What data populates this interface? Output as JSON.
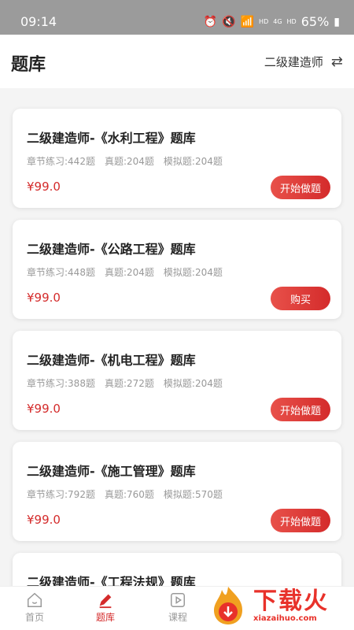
{
  "status_bar": {
    "time": "09:14",
    "hd1": "HD",
    "net": "4G",
    "hd2": "HD",
    "battery": "65%"
  },
  "header": {
    "title": "题库",
    "exam_type": "二级建造师"
  },
  "cards": [
    {
      "title": "二级建造师-《水利工程》题库",
      "chapter": "章节练习:442题",
      "real": "真题:204题",
      "mock": "模拟题:204题",
      "price": "¥99.0",
      "button": "开始做题"
    },
    {
      "title": "二级建造师-《公路工程》题库",
      "chapter": "章节练习:448题",
      "real": "真题:204题",
      "mock": "模拟题:204题",
      "price": "¥99.0",
      "button": "购买"
    },
    {
      "title": "二级建造师-《机电工程》题库",
      "chapter": "章节练习:388题",
      "real": "真题:272题",
      "mock": "模拟题:204题",
      "price": "¥99.0",
      "button": "开始做题"
    },
    {
      "title": "二级建造师-《施工管理》题库",
      "chapter": "章节练习:792题",
      "real": "真题:760题",
      "mock": "模拟题:570题",
      "price": "¥99.0",
      "button": "开始做题"
    },
    {
      "title": "二级建造师-《工程法规》题库"
    }
  ],
  "tabbar": {
    "home": "首页",
    "bank": "题库",
    "course": "课程"
  },
  "watermark": {
    "main": "下载火",
    "sub": "xiazaihuo.com"
  },
  "colors": {
    "accent": "#d42b2b",
    "status_bar": "#9b9b9b"
  }
}
